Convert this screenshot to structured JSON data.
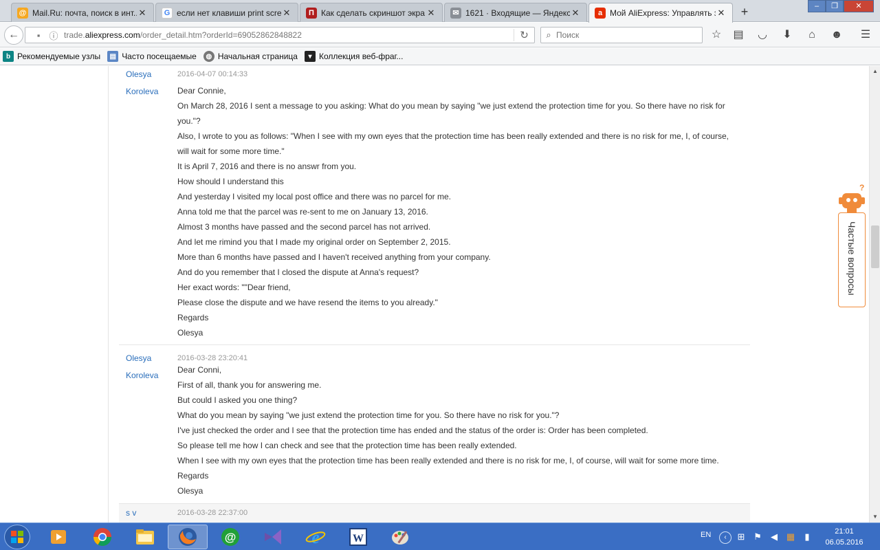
{
  "tabs": [
    {
      "label": "Mail.Ru: почта, поиск в инт...",
      "favicon": "mailru-icon",
      "color": "#f6a821"
    },
    {
      "label": "если нет клавиши print scre...",
      "favicon": "google-icon",
      "color": "#4285f4"
    },
    {
      "label": "Как сделать скриншот экра...",
      "favicon": "site-icon",
      "color": "#b01e1e"
    },
    {
      "label": "1621 · Входящие — Яндекс....",
      "favicon": "mail-envelope-icon",
      "color": "#8a8f96"
    },
    {
      "label": "Мой AliExpress: Управлять з...",
      "favicon": "aliexpress-icon",
      "color": "#e62e04"
    }
  ],
  "address": {
    "prefix": "trade.",
    "domain": "aliexpress.com",
    "path": "/order_detail.htm?orderId=69052862848822"
  },
  "search": {
    "placeholder": "Поиск"
  },
  "bookmarks": [
    {
      "label": "Рекомендуемые узлы",
      "icon": "bing-icon"
    },
    {
      "label": "Часто посещаемые",
      "icon": "folder-icon"
    },
    {
      "label": "Начальная страница",
      "icon": "globe-icon"
    },
    {
      "label": "Коллекция веб-фраг...",
      "icon": "webslice-icon"
    }
  ],
  "messages": [
    {
      "author_first": "Olesya",
      "author_last": "Koroleva",
      "time": "2016-04-07 00:14:33",
      "lines": [
        "Dear Connie,",
        "On March 28, 2016 I sent a message to you asking: What do you mean by saying \"we just extend the protection time for you. So there have no risk for",
        "you.\"?",
        "Also, I wrote to you as follows: \"When I see with my own eyes that the protection time has been really extended and there is no risk for me, I, of course,",
        "will wait for some more time.\"",
        "It is April 7, 2016 and there is no answr from you.",
        "How should I understand this",
        "And yesterday I visited my local post office and there was no parcel for me.",
        "Anna told me that the parcel was re-sent to me on January 13, 2016.",
        "Almost 3 months have passed and the second parcel has not arrived.",
        "And let me rimind you that I made my original order on September 2, 2015.",
        "More than 6 months have passed and I haven't received anything from your company.",
        "And do you remember that I closed the dispute at Anna's request?",
        "Her exact words: \"\"Dear friend,",
        "Please close the dispute and we have resend the items to you already.\"",
        "Regards",
        "Olesya"
      ]
    },
    {
      "author_first": "Olesya",
      "author_last": "Koroleva",
      "time": "2016-03-28 23:20:41",
      "lines": [
        "Dear Conni,",
        "First of all, thank you for answering me.",
        "But could I asked you one thing?",
        "What do you mean by saying \"we just extend the protection time for you. So there have no risk for you.\"?",
        "I've just checked the order and I see that the protection time has ended and the status of the order is: Order has been completed.",
        "So please tell me how I can check and see that the protection time has been really extended.",
        "When I see with my own eyes that the protection time has been really extended and there is no risk for me, I, of course, will wait for some more time.",
        "Regards",
        "Olesya"
      ]
    },
    {
      "author_first": "s v",
      "time": "2016-03-28 22:37:00"
    }
  ],
  "help": {
    "label": "Частые вопросы",
    "accent": "#f08b3a"
  },
  "taskbar": {
    "apps": [
      "media-player-icon",
      "chrome-icon",
      "file-explorer-icon",
      "firefox-icon",
      "mail-agent-icon",
      "visual-studio-icon",
      "internet-explorer-icon",
      "word-icon",
      "paint-icon"
    ],
    "lang": "EN",
    "time": "21:01",
    "date": "06.05.2016"
  }
}
